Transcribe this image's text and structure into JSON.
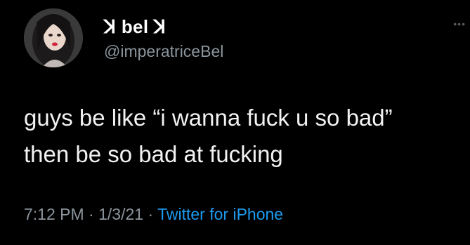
{
  "tweet": {
    "display_name": "ꓘ bel ꓘ",
    "handle": "@imperatriceBel",
    "text_lines": [
      "guys be like “i wanna fuck u so bad”",
      "then be so bad at fucking"
    ],
    "time": "7:12 PM",
    "date": "1/3/21",
    "separator": "·",
    "source": "Twitter for iPhone"
  },
  "icons": {
    "more": "more-options-icon",
    "avatar": "profile-avatar"
  },
  "colors": {
    "background": "#000000",
    "text": "#ffffff",
    "secondary": "#8b949c",
    "link": "#1d9bf0"
  }
}
